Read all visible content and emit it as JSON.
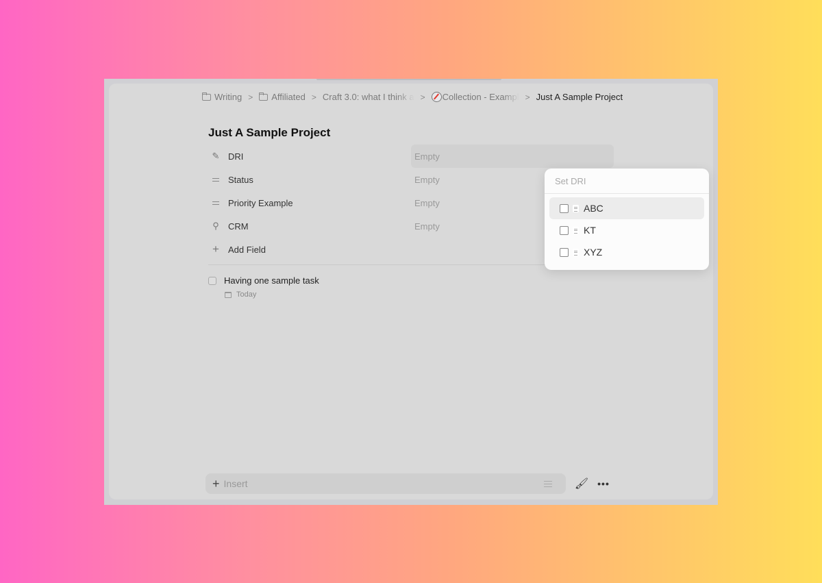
{
  "breadcrumb": [
    {
      "label": "Writing",
      "icon": "folder-icon"
    },
    {
      "label": "Affiliated",
      "icon": "folder-icon"
    },
    {
      "label": "Craft 3.0: what I think a",
      "icon": null
    },
    {
      "label": "Collection - Exampl",
      "icon": "compass-icon"
    },
    {
      "label": "Just A Sample Project",
      "icon": null
    }
  ],
  "page": {
    "title": "Just A Sample Project"
  },
  "properties": [
    {
      "label": "DRI",
      "icon": "person-icon",
      "value": "Empty"
    },
    {
      "label": "Status",
      "icon": "select-icon",
      "value": "Empty"
    },
    {
      "label": "Priority Example",
      "icon": "select-icon",
      "value": "Empty"
    },
    {
      "label": "CRM",
      "icon": "link-icon",
      "value": "Empty"
    }
  ],
  "add_field_label": "Add Field",
  "task": {
    "text": "Having one sample task",
    "due": "Today"
  },
  "popup": {
    "placeholder": "Set DRI",
    "options": [
      "ABC",
      "KT",
      "XYZ"
    ]
  },
  "toolbar": {
    "insert_label": "Insert",
    "more_glyph": "•••"
  }
}
